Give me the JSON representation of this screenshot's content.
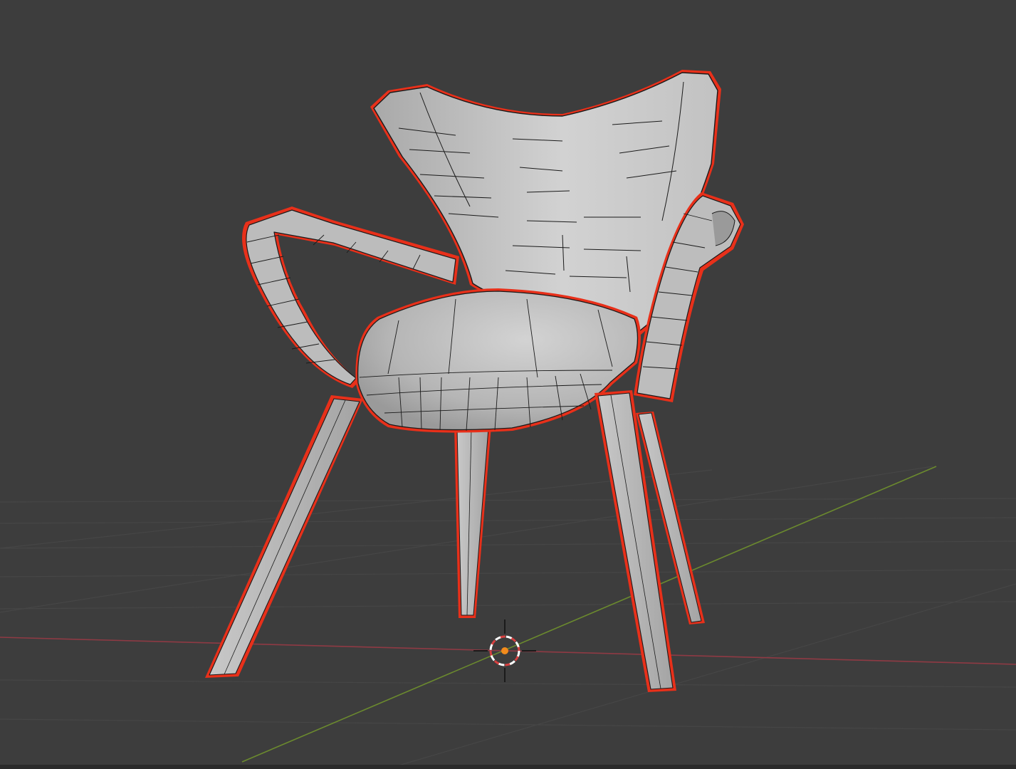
{
  "viewport": {
    "mode": "3D Viewport",
    "background_color": "#3d3d3d",
    "grid": true,
    "axes": {
      "x_axis_color": "#8f3a44",
      "y_axis_color": "#6b8a2e"
    }
  },
  "scene": {
    "object": {
      "type": "chair",
      "selected": true,
      "selection_outline_color": "#e8301a",
      "shading": "solid-with-wireframe",
      "parts": [
        "seat-back",
        "seat-cushion",
        "left-armrest",
        "right-armrest",
        "front-left-leg",
        "front-right-leg",
        "back-left-leg",
        "back-right-leg"
      ]
    },
    "origin_marker_color": "#f28b1c"
  },
  "colors": {
    "mesh_fill": "#b9b9b9",
    "mesh_light": "#d6d6d6",
    "mesh_shadow": "#8a8a8a",
    "wire": "#1a1a1a",
    "grid_line": "#484848"
  }
}
